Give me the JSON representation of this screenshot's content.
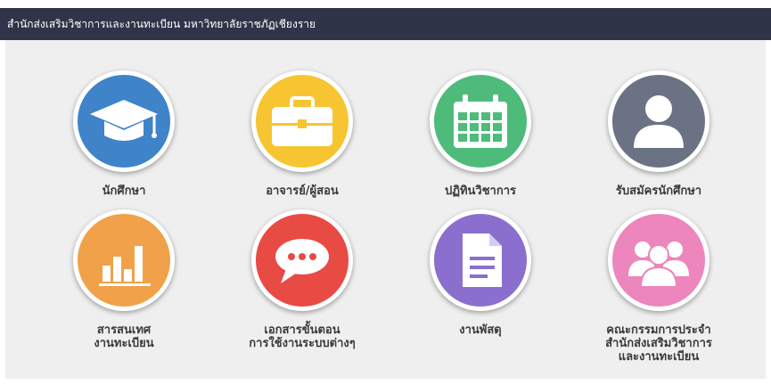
{
  "header": {
    "title": "สำนักส่งเสริมวิชาการและงานทะเบียน มหาวิทยาลัยราชภัฏเชียงราย"
  },
  "tiles": [
    {
      "label": "นักศึกษา",
      "icon": "graduation-cap-icon",
      "color": "#3f83c9"
    },
    {
      "label": "อาจารย์/ผู้สอน",
      "icon": "briefcase-icon",
      "color": "#f7c531"
    },
    {
      "label": "ปฏิทินวิชาการ",
      "icon": "calendar-icon",
      "color": "#4ebb7b"
    },
    {
      "label": "รับสมัครนักศึกษา",
      "icon": "user-icon",
      "color": "#6a7283"
    },
    {
      "label": "สารสนเทศ",
      "label2": "งานทะเบียน",
      "icon": "bar-chart-icon",
      "color": "#f0a14a"
    },
    {
      "label": "เอกสารขั้นตอน",
      "label2": "การใช้งานระบบต่างๆ",
      "icon": "chat-bubble-icon",
      "color": "#e84a44"
    },
    {
      "label": "งานพัสดุ",
      "icon": "document-icon",
      "color": "#8a6fcf"
    },
    {
      "label": "คณะกรรมการประจำ",
      "label2": "สำนักส่งเสริมวิชาการ",
      "label3": "และงานทะเบียน",
      "icon": "group-icon",
      "color": "#ec86bd"
    }
  ]
}
